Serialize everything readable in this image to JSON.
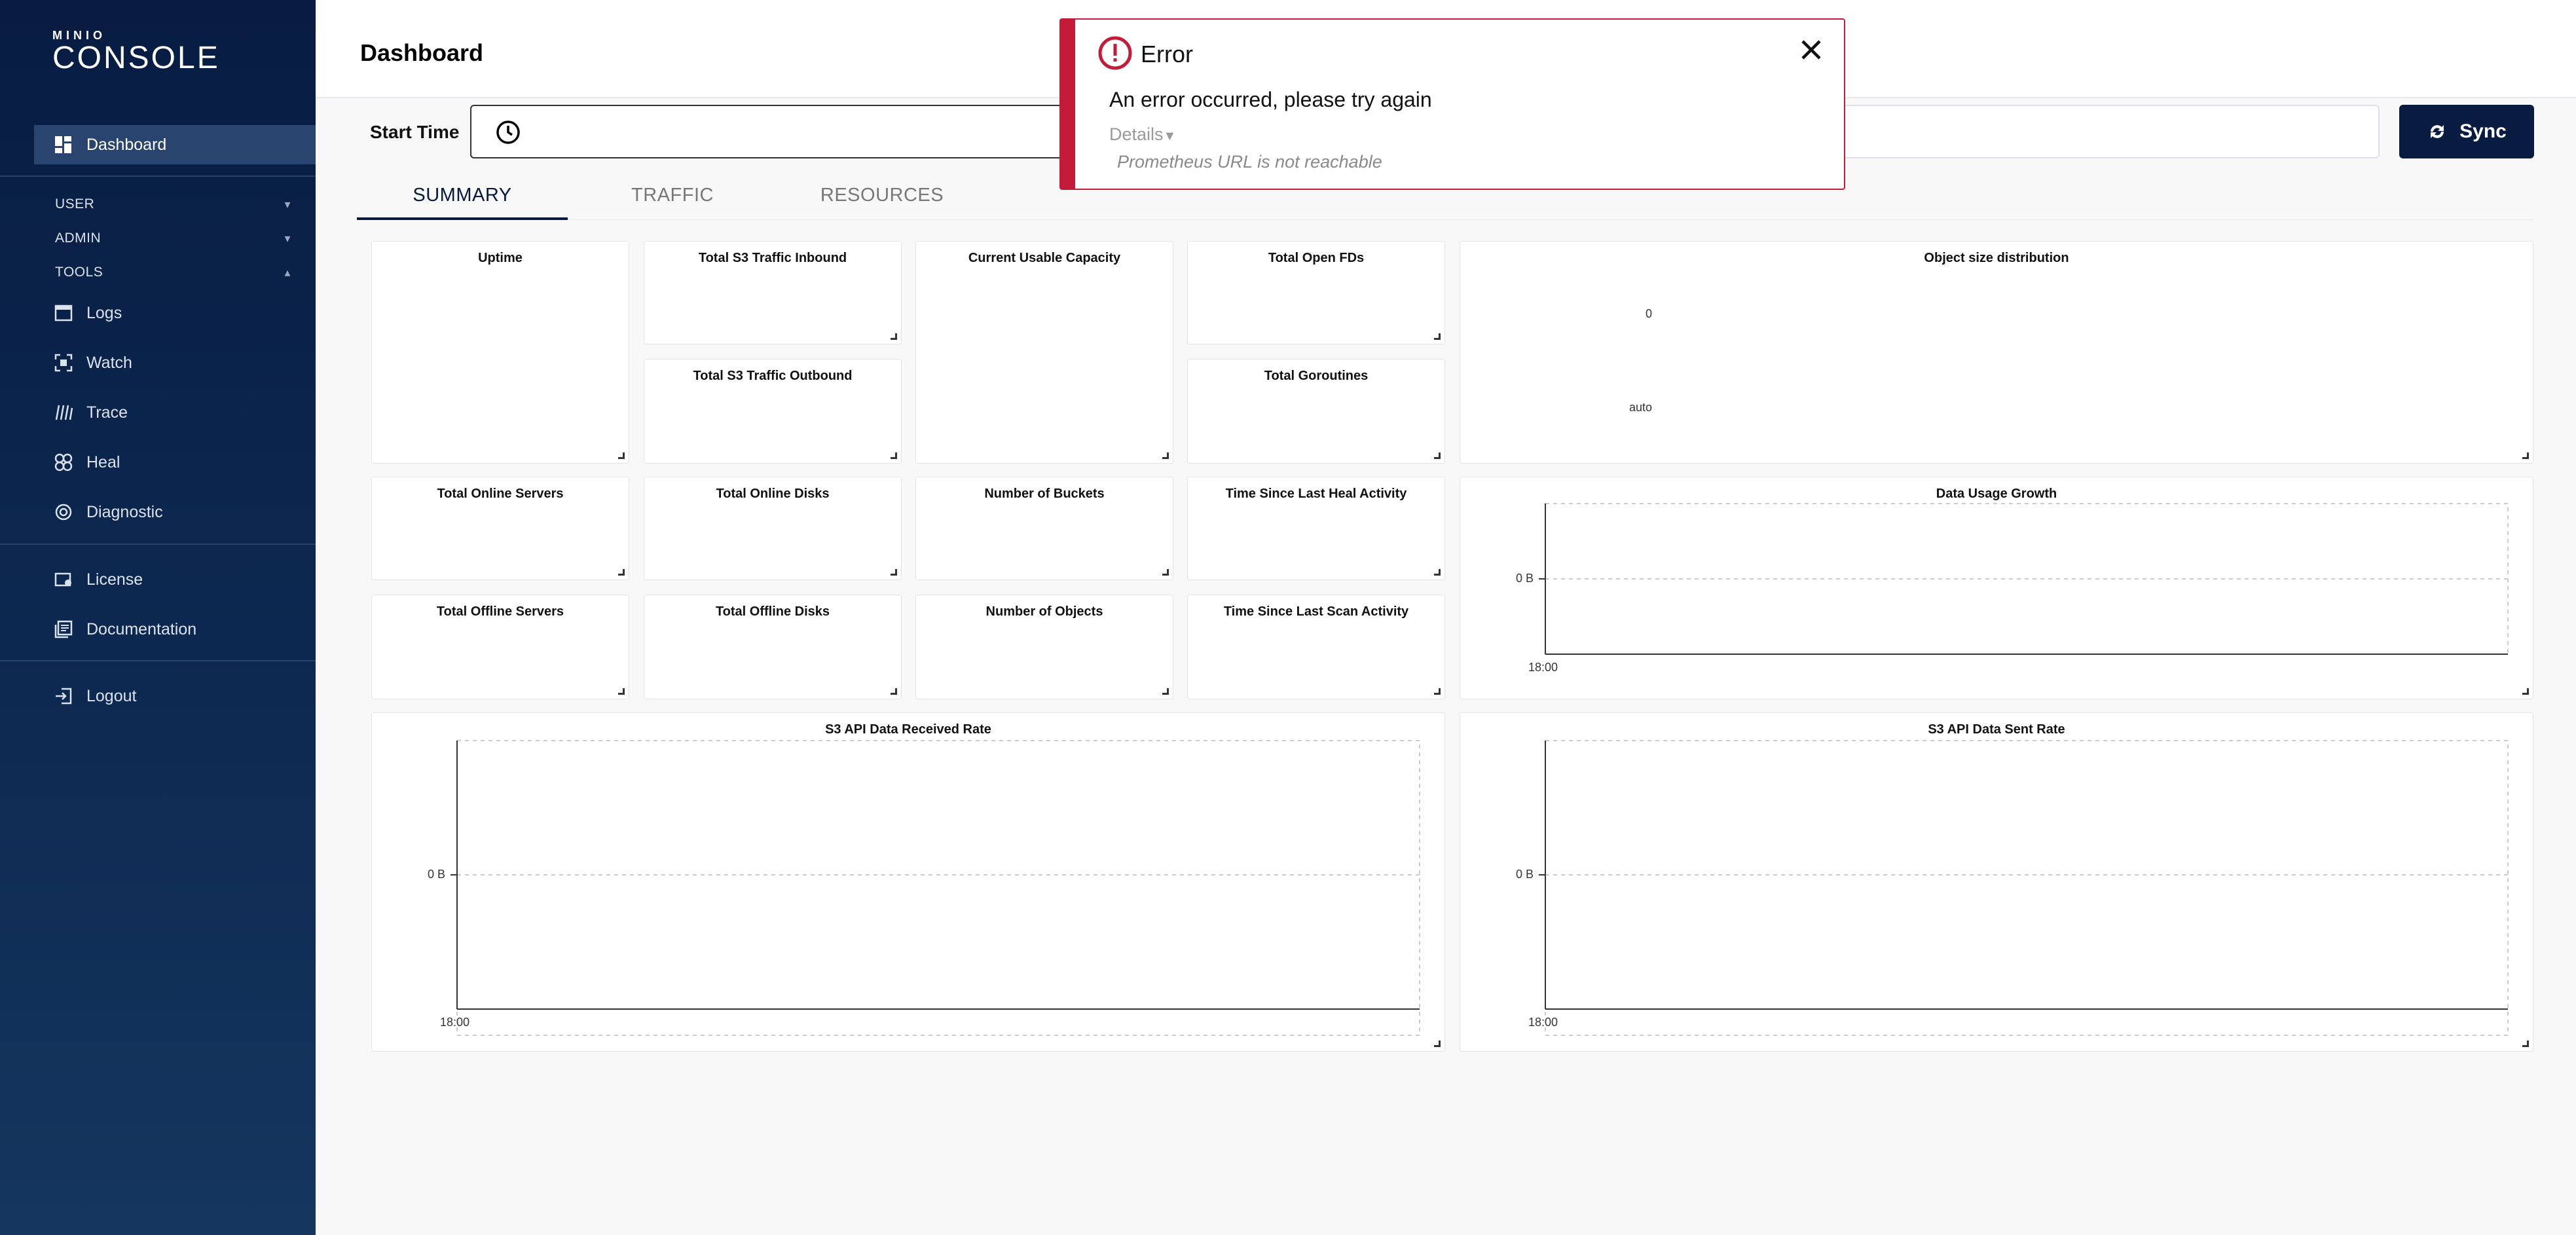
{
  "brand": {
    "top": "MINIO",
    "main": "CONSOLE"
  },
  "sidebar": {
    "dashboard": "Dashboard",
    "sections": {
      "user": "USER",
      "admin": "ADMIN",
      "tools": "TOOLS"
    },
    "tools_items": [
      "Logs",
      "Watch",
      "Trace",
      "Heal",
      "Diagnostic"
    ],
    "license": "License",
    "documentation": "Documentation",
    "logout": "Logout"
  },
  "header": {
    "title": "Dashboard"
  },
  "timebar": {
    "start_label": "Start Time",
    "sync_label": "Sync"
  },
  "tabs": [
    "SUMMARY",
    "TRAFFIC",
    "RESOURCES"
  ],
  "panels": {
    "uptime": "Uptime",
    "s3_in": "Total S3 Traffic Inbound",
    "capacity": "Current Usable Capacity",
    "open_fds": "Total Open FDs",
    "obj_dist": "Object size distribution",
    "s3_out": "Total S3 Traffic Outbound",
    "goroutines": "Total Goroutines",
    "online_servers": "Total Online Servers",
    "online_disks": "Total Online Disks",
    "buckets": "Number of Buckets",
    "heal_activity": "Time Since Last Heal Activity",
    "usage_growth": "Data Usage Growth",
    "offline_servers": "Total Offline Servers",
    "offline_disks": "Total Offline Disks",
    "objects": "Number of Objects",
    "scan_activity": "Time Since Last Scan Activity",
    "recv_rate": "S3 API Data Received Rate",
    "sent_rate": "S3 API Data Sent Rate"
  },
  "obj_dist_labels": {
    "zero": "0",
    "auto": "auto"
  },
  "axis": {
    "y_zero": "0 B",
    "x_time": "18:00"
  },
  "error": {
    "title": "Error",
    "message": "An error occurred, please try again",
    "details_label": "Details",
    "detail_text": "Prometheus URL is not reachable"
  },
  "colors": {
    "sidebar": "#081c42",
    "accent": "#07193e",
    "error": "#c51b3a"
  }
}
